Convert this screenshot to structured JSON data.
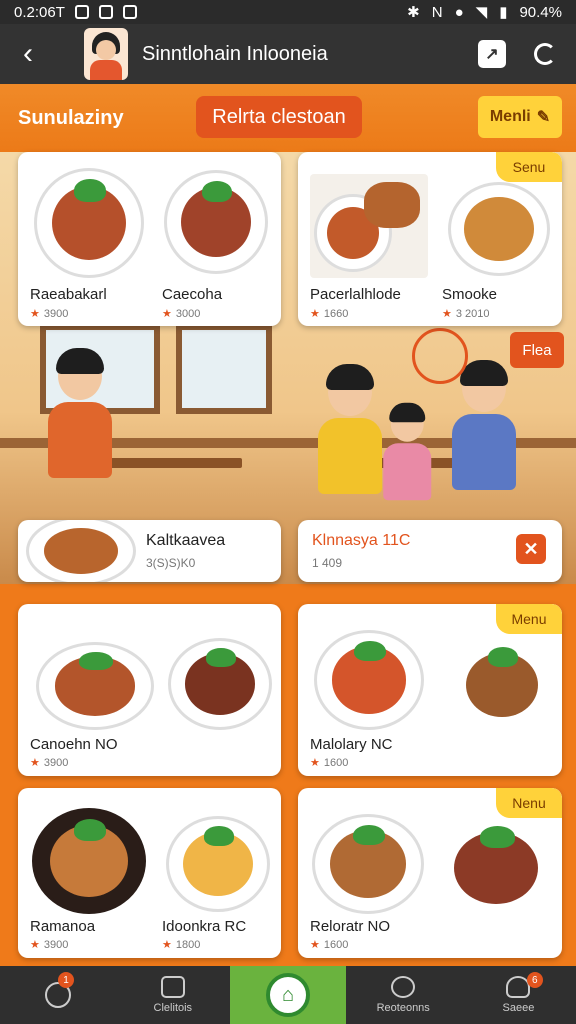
{
  "status_bar": {
    "time": "0.2:06T",
    "battery": "90.4%"
  },
  "app_bar": {
    "title": "Sinntlohain Inlooneia"
  },
  "toolbar": {
    "label": "Sunulaziny",
    "pill": "Relrta clestoan",
    "menu_button": "Menli"
  },
  "top_cards": [
    {
      "dishes": [
        {
          "name": "Raeabakarl",
          "price": "3900"
        },
        {
          "name": "Caecoha",
          "price": "3000"
        }
      ]
    },
    {
      "dishes": [
        {
          "name": "Pacerlalhlode",
          "price": "1660"
        },
        {
          "name": "Smooke",
          "price": "3 2010"
        }
      ],
      "tag": "Senu"
    }
  ],
  "scene": {
    "badge": "Flea"
  },
  "mini_cards": [
    {
      "name": "Kaltkaavea",
      "sub": "3(S)S)K0"
    },
    {
      "name": "Klnnasya 11C",
      "sub": "1 409"
    }
  ],
  "grid_cards": [
    {
      "dishes": [
        {
          "name": "Canoehn NO",
          "price": "3900"
        }
      ]
    },
    {
      "dishes": [
        {
          "name": "Malolary NC",
          "price": "1600"
        }
      ],
      "tag": "Menu"
    },
    {
      "dishes": [
        {
          "name": "Ramanoa",
          "price": "3900"
        },
        {
          "name": "Idoonkra RC",
          "price": "1800"
        }
      ]
    },
    {
      "dishes": [
        {
          "name": "Reloratr NO",
          "price": "1600"
        }
      ],
      "tag": "Nenu"
    }
  ],
  "bottom_nav": [
    {
      "label": "",
      "badge": "1"
    },
    {
      "label": "Clelitois"
    },
    {
      "label": ""
    },
    {
      "label": "Reoteonns"
    },
    {
      "label": "Saeee",
      "badge": "6"
    }
  ],
  "colors": {
    "accent": "#ef7a1a",
    "pill": "#e2541e",
    "menu": "#ffd23a",
    "nav_active": "#6ab33e"
  }
}
